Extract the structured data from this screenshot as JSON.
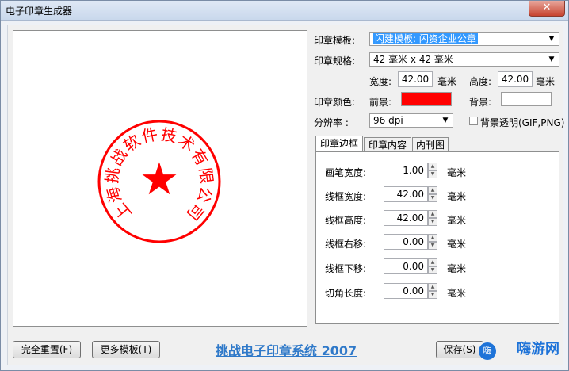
{
  "window": {
    "title": "电子印章生成器",
    "close_label": "✕"
  },
  "seal": {
    "ring_text": "上海挑战软件技术有限公司",
    "color": "#ff0000",
    "star": "★"
  },
  "form": {
    "template_label": "印章模板:",
    "template_value": "闪建模板: 闪资企业公章",
    "size_label": "印章规格:",
    "size_value": "42 毫米 x 42 毫米",
    "width_label": "宽度:",
    "width_value": "42.00",
    "width_unit": "毫米",
    "height_label": "高度:",
    "height_value": "42.00",
    "height_unit": "毫米",
    "color_label": "印章颜色:",
    "fg_label": "前景:",
    "fg_color": "#ff0000",
    "bg_label": "背景:",
    "bg_color": "#ffffff",
    "dpi_label": "分辨率  :",
    "dpi_value": "96 dpi",
    "transparent_label": "背景透明(GIF,PNG)"
  },
  "tabs": [
    {
      "label": "印章边框"
    },
    {
      "label": "印章内容"
    },
    {
      "label": "内刊图"
    }
  ],
  "border_panel": {
    "rows": [
      {
        "label": "画笔宽度:",
        "value": "1.00",
        "unit": "毫米"
      },
      {
        "label": "线框宽度:",
        "value": "42.00",
        "unit": "毫米"
      },
      {
        "label": "线框高度:",
        "value": "42.00",
        "unit": "毫米"
      },
      {
        "label": "线框右移:",
        "value": "0.00",
        "unit": "毫米"
      },
      {
        "label": "线框下移:",
        "value": "0.00",
        "unit": "毫米"
      },
      {
        "label": "切角长度:",
        "value": "0.00",
        "unit": "毫米"
      }
    ]
  },
  "buttons": {
    "reset": "完全重置(F)",
    "more_templates": "更多模板(T)",
    "save": "保存(S)"
  },
  "system_title": "挑战电子印章系统 2007",
  "watermark": "嗨游网"
}
